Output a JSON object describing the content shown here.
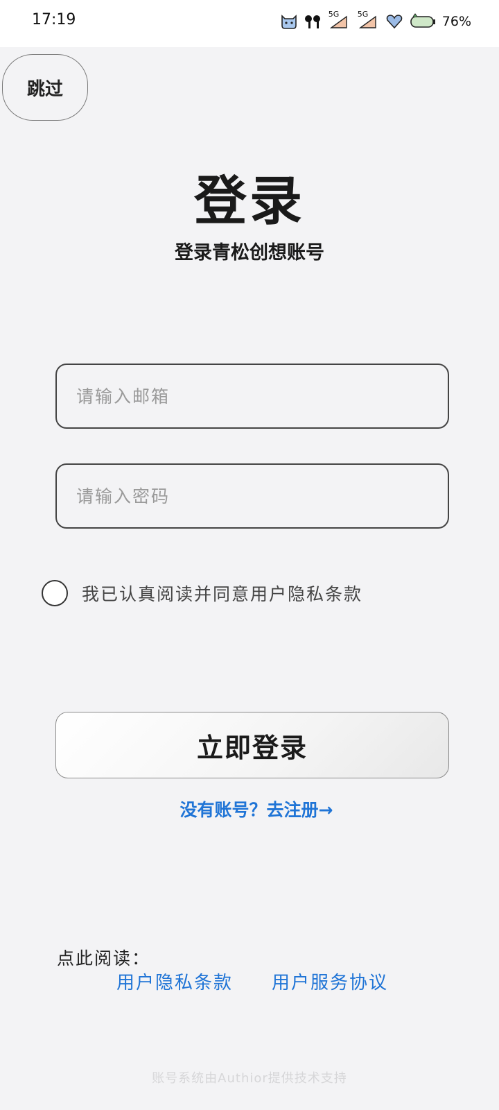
{
  "status_bar": {
    "time": "17:19",
    "battery_percent": "76%",
    "signal_1_label": "5G",
    "signal_2_label": "5G",
    "icons": [
      "cat-icon",
      "earbuds-icon",
      "signal-5g-icon",
      "signal-5g-icon",
      "heart-icon",
      "battery-icon"
    ]
  },
  "header": {
    "skip_label": "跳过",
    "title": "登录",
    "subtitle": "登录青松创想账号"
  },
  "form": {
    "email_placeholder": "请输入邮箱",
    "email_value": "",
    "password_placeholder": "请输入密码",
    "password_value": "",
    "agree_text": "我已认真阅读并同意用户隐私条款",
    "agree_checked": false,
    "login_label": "立即登录",
    "register_label": "没有账号？去注册→"
  },
  "docs": {
    "read_label": "点此阅读：",
    "privacy_label": "用户隐私条款",
    "service_label": "用户服务协议"
  },
  "footer": {
    "text": "账号系统由Authior提供技术支持"
  },
  "colors": {
    "background": "#f3f3f5",
    "link": "#1f74d6",
    "border": "#444444"
  }
}
